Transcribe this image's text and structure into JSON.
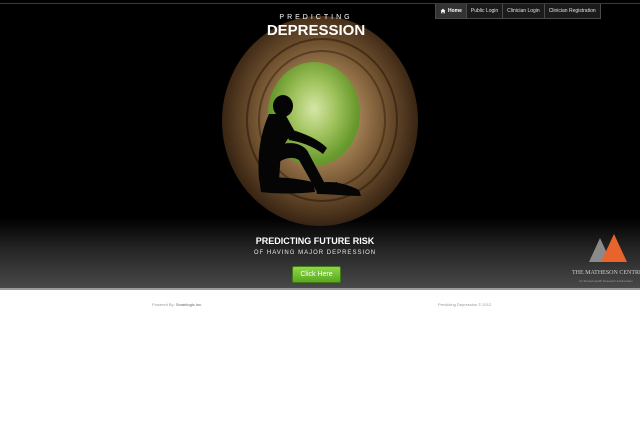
{
  "nav": {
    "items": [
      {
        "label": "Home",
        "icon": "home-icon"
      },
      {
        "label": "Public Login"
      },
      {
        "label": "Clinician Login"
      },
      {
        "label": "Clinician Registration"
      }
    ]
  },
  "brand": {
    "top": "PREDICTING",
    "main": "DEPRESSION"
  },
  "hero": {
    "heading": "PREDICTING FUTURE RISK",
    "subheading": "OF HAVING MAJOR DEPRESSION",
    "cta_label": "Click Here"
  },
  "partner": {
    "name": "THE MATHESON CENTRE",
    "tagline": "for Mental Health Research & Education",
    "colors": {
      "dark": "#8a8a8a",
      "accent": "#e8642a"
    }
  },
  "footer": {
    "powered_prefix": "Powered By:",
    "company": "Smartlogic Inc.",
    "copyright": "Predicting Depression © 2012"
  }
}
